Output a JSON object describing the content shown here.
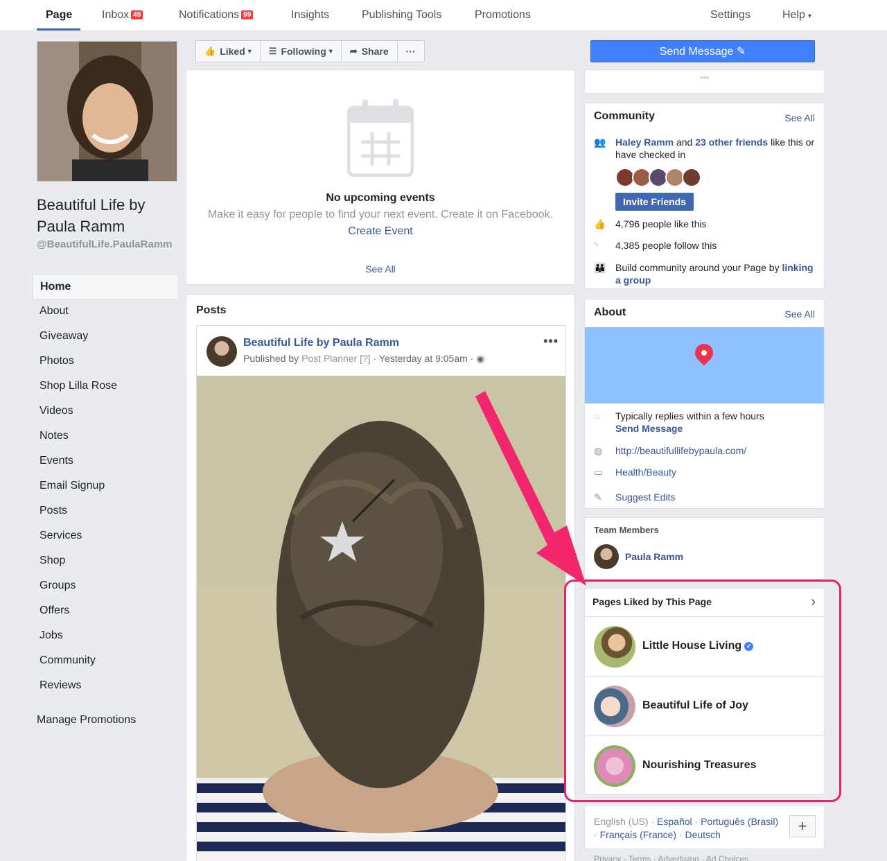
{
  "topnav": {
    "items": [
      {
        "label": "Page"
      },
      {
        "label": "Inbox",
        "badge": "49"
      },
      {
        "label": "Notifications",
        "badge": "99"
      },
      {
        "label": "Insights"
      },
      {
        "label": "Publishing Tools"
      },
      {
        "label": "Promotions"
      }
    ],
    "settings": "Settings",
    "help": "Help"
  },
  "page": {
    "name": "Beautiful Life by Paula Ramm",
    "handle": "@BeautifulLife.PaulaRamm"
  },
  "leftnav": [
    "Home",
    "About",
    "Giveaway",
    "Photos",
    "Shop Lilla Rose",
    "Videos",
    "Notes",
    "Events",
    "Email Signup",
    "Posts",
    "Services",
    "Shop",
    "Groups",
    "Offers",
    "Jobs",
    "Community",
    "Reviews"
  ],
  "manage_promotions": "Manage Promotions",
  "actions": {
    "liked": "Liked",
    "following": "Following",
    "share": "Share",
    "more": "···",
    "send_message": "Send Message"
  },
  "events": {
    "title": "No upcoming events",
    "subtitle": "Make it easy for people to find your next event. Create it on Facebook.",
    "create": "Create Event",
    "see_all": "See All"
  },
  "posts": {
    "heading": "Posts",
    "author": "Beautiful Life by Paula Ramm",
    "published_by": "Published by",
    "planner": "Post Planner",
    "help": "[?]",
    "time": "· Yesterday at 9:05am ·",
    "more": "•••"
  },
  "community": {
    "title": "Community",
    "see_all": "See All",
    "friend": "Haley Ramm",
    "and": "and",
    "others": "23 other friends",
    "like_text": "like this or have checked in",
    "invite": "Invite Friends",
    "likes": "4,796 people like this",
    "follows": "4,385 people follow this",
    "build": "Build community around your Page by",
    "link_group": "linking a group"
  },
  "about": {
    "title": "About",
    "see_all": "See All",
    "replies": "Typically replies within a few hours",
    "send": "Send Message",
    "url": "http://beautifullifebypaula.com/",
    "category": "Health/Beauty",
    "suggest": "Suggest Edits"
  },
  "team": {
    "title": "Team Members",
    "member": "Paula Ramm"
  },
  "liked_pages": {
    "title": "Pages Liked by This Page",
    "pages": [
      {
        "name": "Little House Living",
        "verified": true
      },
      {
        "name": "Beautiful Life of Joy"
      },
      {
        "name": "Nourishing Treasures"
      }
    ]
  },
  "languages": {
    "current": "English (US)",
    "others": [
      "Español",
      "Português (Brasil)",
      "Français (France)",
      "Deutsch"
    ]
  },
  "footer": "Privacy · Terms · Advertising · Ad Choices",
  "colors": {
    "brand": "#4267b2",
    "send": "#4080ff",
    "highlight": "#e61f6e"
  }
}
